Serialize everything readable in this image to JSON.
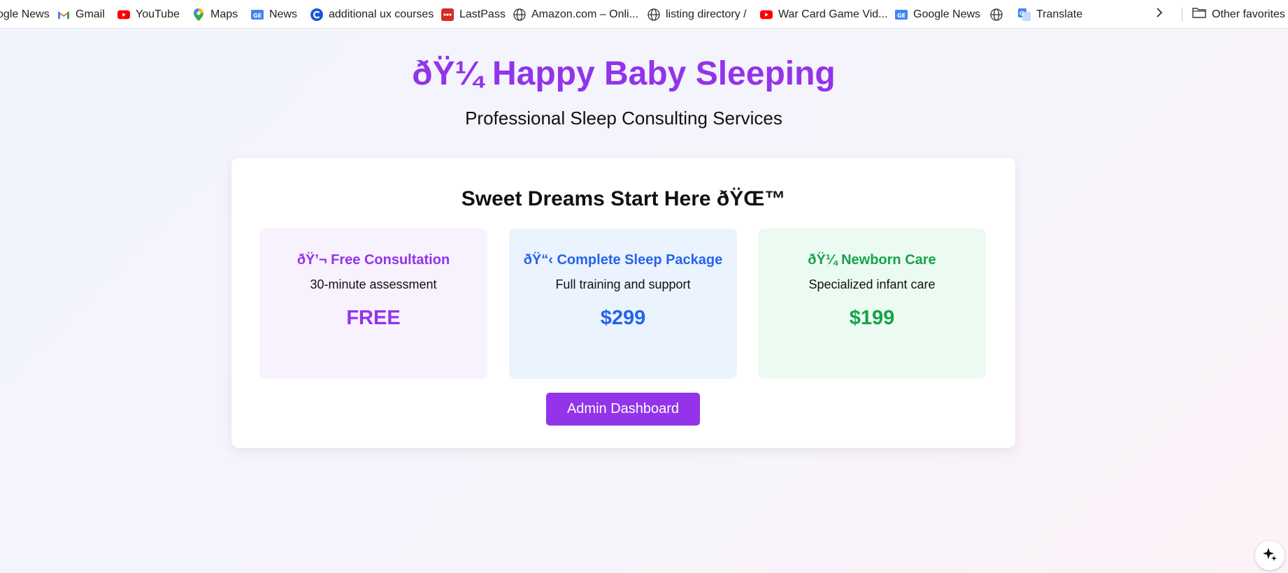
{
  "bookmarks": {
    "items": [
      {
        "label": "ogle News",
        "icon": "google-news-icon"
      },
      {
        "label": "Gmail",
        "icon": "gmail-icon"
      },
      {
        "label": "YouTube",
        "icon": "youtube-icon"
      },
      {
        "label": "Maps",
        "icon": "maps-icon"
      },
      {
        "label": "News",
        "icon": "google-news-icon"
      },
      {
        "label": "additional ux courses",
        "icon": "coursera-icon"
      },
      {
        "label": "LastPass",
        "icon": "lastpass-icon"
      },
      {
        "label": "Amazon.com – Onli...",
        "icon": "globe-icon"
      },
      {
        "label": "listing directory /",
        "icon": "globe-icon"
      },
      {
        "label": "War Card Game Vid...",
        "icon": "youtube-icon"
      },
      {
        "label": "Google News",
        "icon": "google-news-icon"
      },
      {
        "label": "",
        "icon": "globe-icon"
      },
      {
        "label": "Translate",
        "icon": "translate-icon"
      }
    ],
    "other_favorites": "Other favorites"
  },
  "header": {
    "title": "ðŸ¼ Happy Baby Sleeping",
    "subtitle": "Professional Sleep Consulting Services"
  },
  "card": {
    "title": "Sweet Dreams Start Here ðŸŒ™",
    "services": [
      {
        "name": "ðŸ’¬ Free Consultation",
        "description": "30-minute assessment",
        "price": "FREE"
      },
      {
        "name": "ðŸ“‹ Complete Sleep Package",
        "description": "Full training and support",
        "price": "$299"
      },
      {
        "name": "ðŸ¼ Newborn Care",
        "description": "Specialized infant care",
        "price": "$199"
      }
    ],
    "admin_button": "Admin Dashboard"
  },
  "colors": {
    "purple": "#9333ea",
    "blue": "#2563eb",
    "green": "#16a34a"
  }
}
